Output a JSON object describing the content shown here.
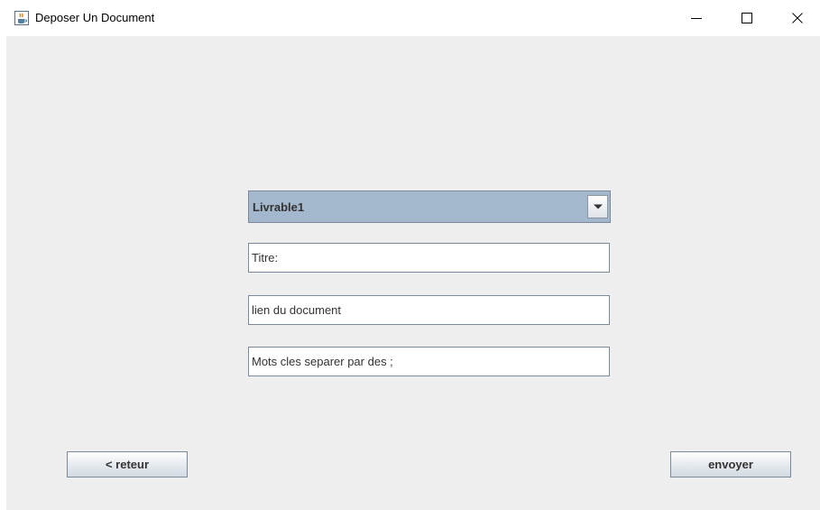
{
  "window": {
    "title": "Deposer Un Document",
    "icon": "java-cup-icon",
    "controls": [
      "minimize-icon",
      "maximize-icon",
      "close-icon"
    ]
  },
  "form": {
    "livrable_select": {
      "selected": "Livrable1",
      "icon": "chevron-down-icon"
    },
    "titre_field": {
      "value": "Titre:"
    },
    "lien_field": {
      "value": "lien du document"
    },
    "mots_field": {
      "value": "Mots cles separer par des ;"
    }
  },
  "buttons": {
    "retour_label": "< reteur",
    "envoyer_label": "envoyer"
  },
  "colors": {
    "panel_bg": "#eeeeee",
    "combo_bg": "#a3b8cc",
    "border": "#7a8a99"
  }
}
